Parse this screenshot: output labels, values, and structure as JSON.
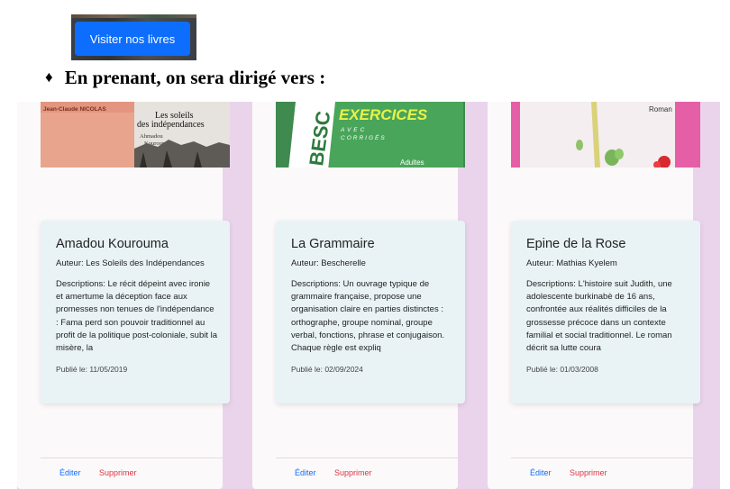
{
  "top_button": {
    "label": "Visiter nos livres"
  },
  "heading": {
    "bullet": "♦",
    "text": "En prenant, on sera dirigé vers :"
  },
  "books": [
    {
      "cover": {
        "author_band": "Jean-Claude NICOLAS",
        "title_line1": "Les soleils",
        "title_line2": "des indépendances",
        "author_line1": "Ahmadou",
        "author_line2": "Kourouma"
      },
      "title": "Amadou Kourouma",
      "author": "Auteur: Les Soleils des Indépendances",
      "description": "Descriptions: Le récit dépeint avec ironie et amertume la déception face aux promesses non tenues de l'indépendance : Fama perd son pouvoir traditionnel au profit de la politique post-coloniale, subit la misère, la",
      "date": "Publié le: 11/05/2019",
      "edit_label": "Éditer",
      "delete_label": "Supprimer"
    },
    {
      "cover": {
        "spine": "BESC",
        "title": "EXERCICES",
        "subtitle_line1": "AVEC",
        "subtitle_line2": "CORRIGÉS",
        "badge": "Adultes"
      },
      "title": "La Grammaire",
      "author": "Auteur: Bescherelle",
      "description": "Descriptions: Un ouvrage typique de grammaire française, propose une organisation claire en parties distinctes : orthographe, groupe nominal, groupe verbal, fonctions, phrase et conjugaison. Chaque règle est expliq",
      "date": "Publié le: 02/09/2024",
      "edit_label": "Éditer",
      "delete_label": "Supprimer"
    },
    {
      "cover": {
        "tag": "Roman"
      },
      "title": "Epine de la Rose",
      "author": "Auteur: Mathias Kyelem",
      "description": "Descriptions: L'histoire suit Judith, une adolescente burkinabè de 16 ans, confrontée aux réalités difficiles de la grossesse précoce dans un contexte familial et social traditionnel. Le roman décrit sa lutte coura",
      "date": "Publié le: 01/03/2008",
      "edit_label": "Éditer",
      "delete_label": "Supprimer"
    }
  ]
}
